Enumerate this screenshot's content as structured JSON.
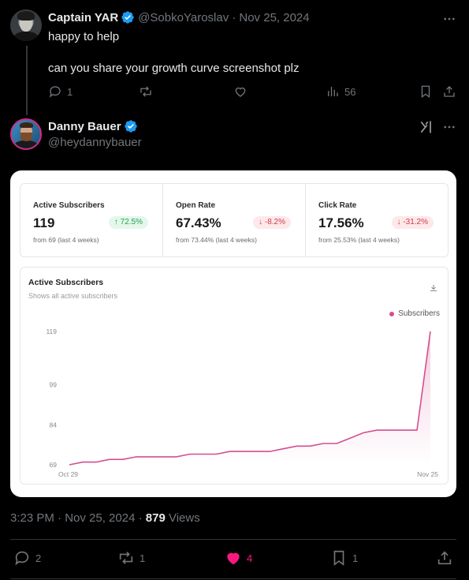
{
  "reply": {
    "author_name": "Captain YAR",
    "author_handle": "@SobkoYaroslav",
    "date": "· Nov 25, 2024",
    "line1": "happy to help",
    "line2": "can you share your growth curve screenshot plz",
    "replies": "1",
    "views": "56",
    "icons": [
      "reply-icon",
      "retweet-icon",
      "like-icon",
      "views-icon",
      "bookmark-icon",
      "share-icon",
      "more-icon",
      "verified-icon"
    ]
  },
  "tweet": {
    "author_name": "Danny Bauer",
    "author_handle": "@heydannybauer",
    "timestamp": "3:23 PM · Nov 25, 2024 · ",
    "views_count": "879",
    "views_label": " Views",
    "replies": "2",
    "retweets": "1",
    "likes": "4",
    "bookmarks": "1",
    "like_color": "#f91880",
    "verified_color": "#1d9bf0"
  },
  "dashboard": {
    "stats": [
      {
        "label": "Active Subscribers",
        "value": "119",
        "change": "↑ 72.5%",
        "direction": "up",
        "sub": "from 69 (last 4 weeks)"
      },
      {
        "label": "Open Rate",
        "value": "67.43%",
        "change": "↓ -8.2%",
        "direction": "down",
        "sub": "from 73.44% (last 4 weeks)"
      },
      {
        "label": "Click Rate",
        "value": "17.56%",
        "change": "↓ -31.2%",
        "direction": "down",
        "sub": "from 25.53% (last 4 weeks)"
      }
    ],
    "chart_title": "Active Subscribers",
    "chart_subtitle": "Shows all active subscribers",
    "legend": "Subscribers"
  },
  "chart_data": {
    "type": "area",
    "series": [
      {
        "name": "Subscribers",
        "color": "#d34f8e",
        "values": [
          69,
          70,
          70,
          71,
          71,
          72,
          72,
          72,
          72,
          73,
          73,
          73,
          74,
          74,
          74,
          74,
          75,
          76,
          76,
          77,
          77,
          79,
          81,
          82,
          82,
          82,
          82,
          119
        ]
      }
    ],
    "x_start_label": "Oct 29",
    "x_end_label": "Nov 25",
    "yticks": [
      "69",
      "84",
      "99",
      "119"
    ],
    "ylim": [
      69,
      119
    ],
    "grid": false,
    "legend": "top-right"
  }
}
